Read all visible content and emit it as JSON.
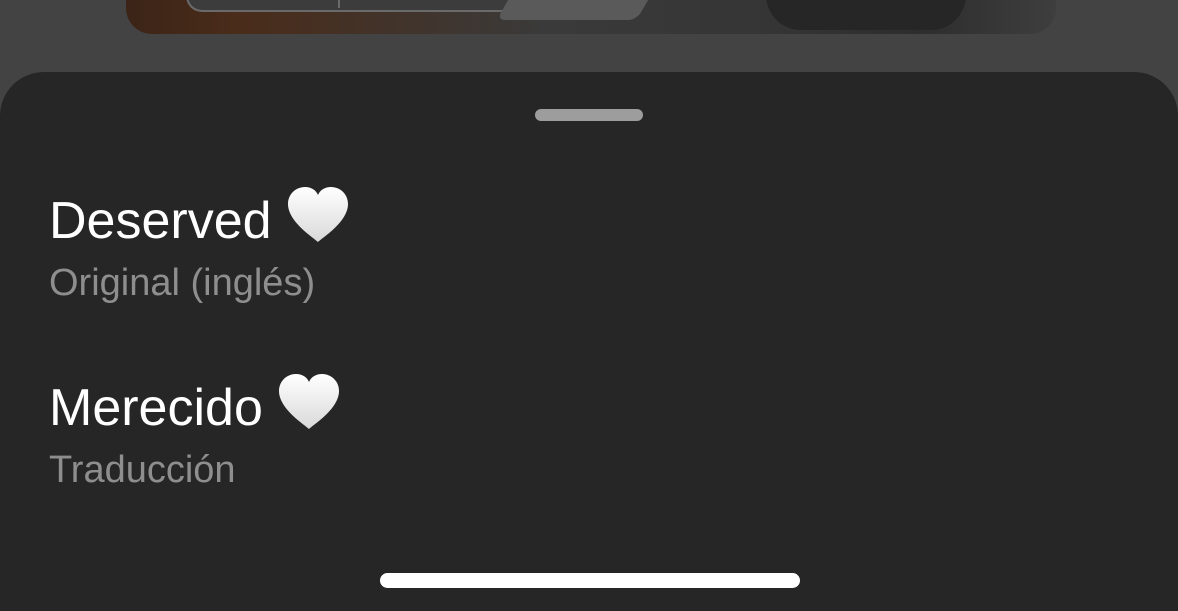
{
  "original": {
    "text": "Deserved",
    "emoji_icon": "white-heart-icon",
    "label": "Original (inglés)"
  },
  "translation": {
    "text": "Merecido",
    "emoji_icon": "white-heart-icon",
    "label": "Traducción"
  },
  "colors": {
    "sheet_background": "#262626",
    "backdrop": "#434343",
    "primary_text": "#ffffff",
    "secondary_text": "#8e8e8e",
    "grabber": "#9d9d9d",
    "home_indicator": "#ffffff"
  }
}
